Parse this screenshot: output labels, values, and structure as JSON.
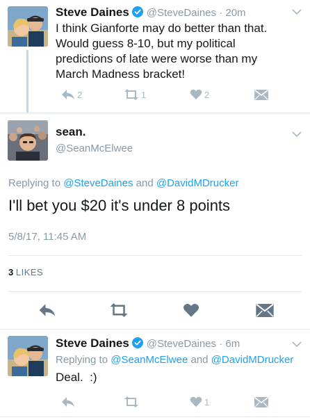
{
  "tweet1": {
    "name": "Steve Daines",
    "handle": "@SteveDaines",
    "time": "20m",
    "text_lines": [
      "I think Gianforte may do better than that.",
      "Would guess 8-10, but my political",
      "predictions of late were worse than my",
      "March Madness bracket!"
    ],
    "reply_count": "2",
    "retweet_count": "1",
    "like_count": "2"
  },
  "tweet2": {
    "name": "sean.",
    "handle": "@SeanMcElwee",
    "replying_prefix": "Replying to",
    "replying_user1": "@SteveDaines",
    "replying_and": "and",
    "replying_user2": "@DavidMDrucker",
    "text": "I'll bet you $20 it's under 8 points",
    "timestamp": "5/8/17, 11:45 AM",
    "likes_count": "3",
    "likes_label": "LIKES"
  },
  "tweet3": {
    "name": "Steve Daines",
    "handle": "@SteveDaines",
    "time": "6m",
    "replying_prefix": "Replying to",
    "replying_user1": "@SeanMcElwee",
    "replying_and": "and",
    "replying_user2": "@DavidMDrucker",
    "text": "Deal.  :)",
    "like_count": "1"
  },
  "colors": {
    "link": "#1da1f2",
    "muted": "#8899a6",
    "icon": "#aab8c2",
    "detail_icon": "#657786",
    "divider": "#e1e8ed"
  },
  "icons": [
    "reply-icon",
    "retweet-icon",
    "heart-icon",
    "dm-icon",
    "verified-icon",
    "chevron-down-icon"
  ]
}
